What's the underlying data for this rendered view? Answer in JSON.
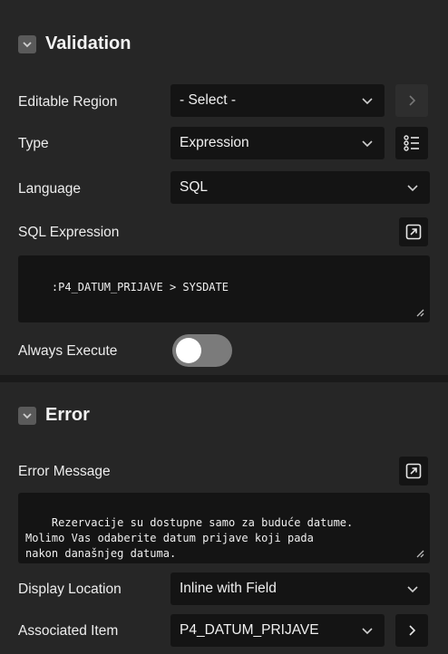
{
  "validation": {
    "title": "Validation",
    "editable_region": {
      "label": "Editable Region",
      "value": "- Select -"
    },
    "type": {
      "label": "Type",
      "value": "Expression"
    },
    "language": {
      "label": "Language",
      "value": "SQL"
    },
    "sql_expression": {
      "label": "SQL Expression",
      "value": ":P4_DATUM_PRIJAVE > SYSDATE"
    },
    "always_execute": {
      "label": "Always Execute",
      "on": false
    }
  },
  "error": {
    "title": "Error",
    "error_message": {
      "label": "Error Message",
      "value": "Rezervacije su dostupne samo za buduće datume.\nMolimo Vas odaberite datum prijave koji pada\nnakon današnjeg datuma."
    },
    "display_location": {
      "label": "Display Location",
      "value": "Inline with Field"
    },
    "associated_item": {
      "label": "Associated Item",
      "value": "P4_DATUM_PRIJAVE"
    }
  },
  "colors": {
    "panel_bg": "#262626",
    "field_bg": "#141414",
    "toggle_off": "#7b7b7b"
  }
}
